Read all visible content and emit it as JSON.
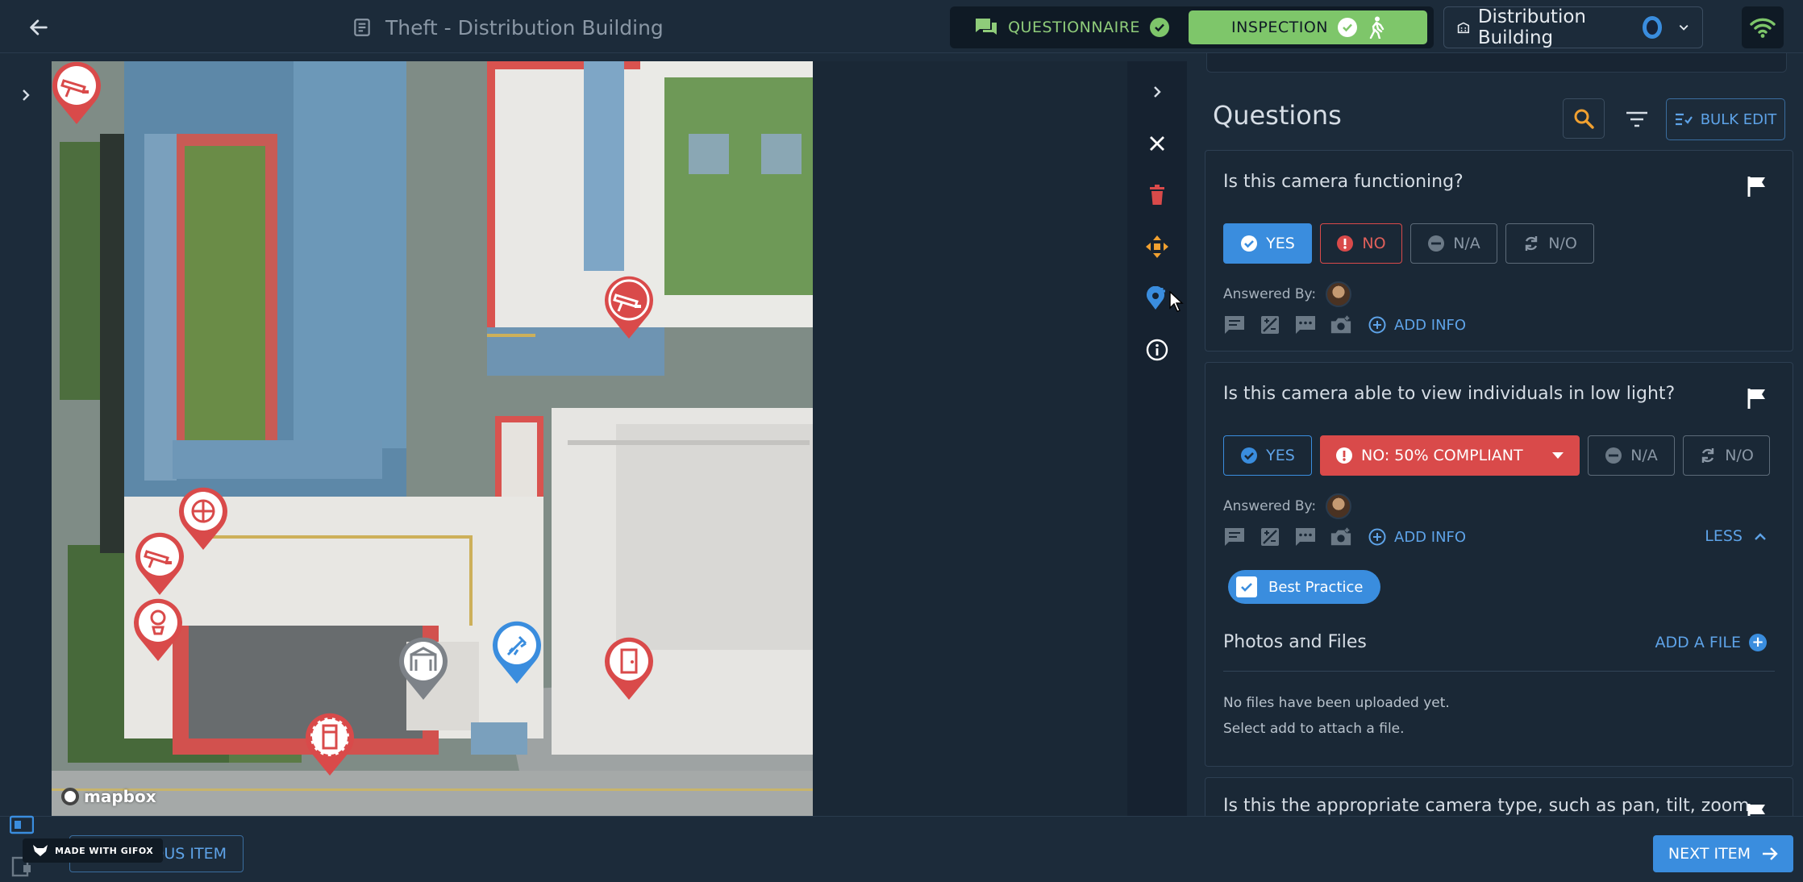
{
  "header": {
    "title": "Theft - Distribution Building",
    "questionnaire_label": "QUESTIONNAIRE",
    "inspection_label": "INSPECTION",
    "building_name": "Distribution Building"
  },
  "map": {
    "attribution": "mapbox"
  },
  "panel": {
    "heading": "Questions",
    "bulk_edit_label": "BULK EDIT"
  },
  "questions": [
    {
      "text": "Is this camera functioning?",
      "answers": {
        "yes": "YES",
        "no": "NO",
        "na": "N/A",
        "no_obs": "N/O"
      },
      "selected": "YES",
      "answered_by_label": "Answered By:",
      "add_info_label": "ADD INFO"
    },
    {
      "text": "Is this camera able to view individuals in low light?",
      "answers": {
        "yes": "YES",
        "no": "NO: 50% COMPLIANT",
        "na": "N/A",
        "no_obs": "N/O"
      },
      "selected": "NO: 50% COMPLIANT",
      "answered_by_label": "Answered By:",
      "add_info_label": "ADD INFO",
      "less_label": "LESS",
      "tag": "Best Practice",
      "photos_title": "Photos and Files",
      "add_file_label": "ADD A FILE",
      "empty_line1": "No files have been uploaded yet.",
      "empty_line2": "Select add to attach a file."
    },
    {
      "text": "Is this the appropriate camera type, such as pan, tilt, zoom"
    }
  ],
  "footer": {
    "prev_label": "PREVIOUS ITEM",
    "next_label": "NEXT ITEM",
    "watermark": "MADE WITH GIFOX"
  },
  "colors": {
    "accent": "#3a8dde",
    "danger": "#d94a4a",
    "success": "#7ec66a",
    "warning": "#f0a030",
    "background": "#1c2b3a"
  },
  "icons": [
    "back-arrow-icon",
    "document-icon",
    "chat-icon",
    "check-icon",
    "walking-icon",
    "building-icon",
    "chevron-down-icon",
    "wifi-icon",
    "chevron-right-icon",
    "close-icon",
    "trash-icon",
    "move-icon",
    "add-location-icon",
    "info-icon",
    "search-icon",
    "filter-icon",
    "bulk-edit-icon",
    "flag-icon",
    "alert-icon",
    "minus-icon",
    "refresh-icon",
    "comment-icon",
    "edit-image-icon",
    "message-icon",
    "camera-icon",
    "plus-circle-icon",
    "chevron-up-icon",
    "checkbox-icon",
    "arrow-right-icon"
  ]
}
